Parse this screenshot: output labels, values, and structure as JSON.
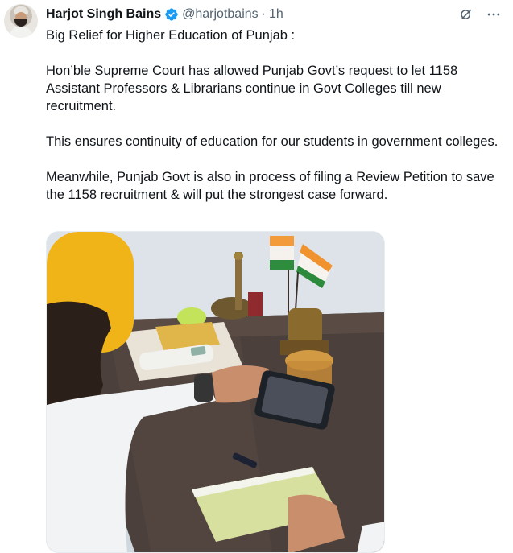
{
  "author": {
    "name": "Harjot Singh Bains",
    "handle": "@harjotbains",
    "separator": "·",
    "time": "1h",
    "verified_color": "#1d9bf0"
  },
  "icons": {
    "grok": "grok-icon",
    "more": "more-icon",
    "verified": "verified-badge-icon"
  },
  "tweet": {
    "paragraphs": [
      "Big Relief for Higher Education of Punjab :",
      "Hon’ble Supreme Court has allowed Punjab Govt’s request to let 1158 Assistant Professors & Librarians continue in Govt Colleges till new recruitment.",
      "This ensures continuity of education for our students in government colleges.",
      "Meanwhile, Punjab Govt is also in process of filing a Review Petition to save the 1158 recruitment & will put the strongest case forward."
    ]
  },
  "media": {
    "kind": "photo"
  }
}
